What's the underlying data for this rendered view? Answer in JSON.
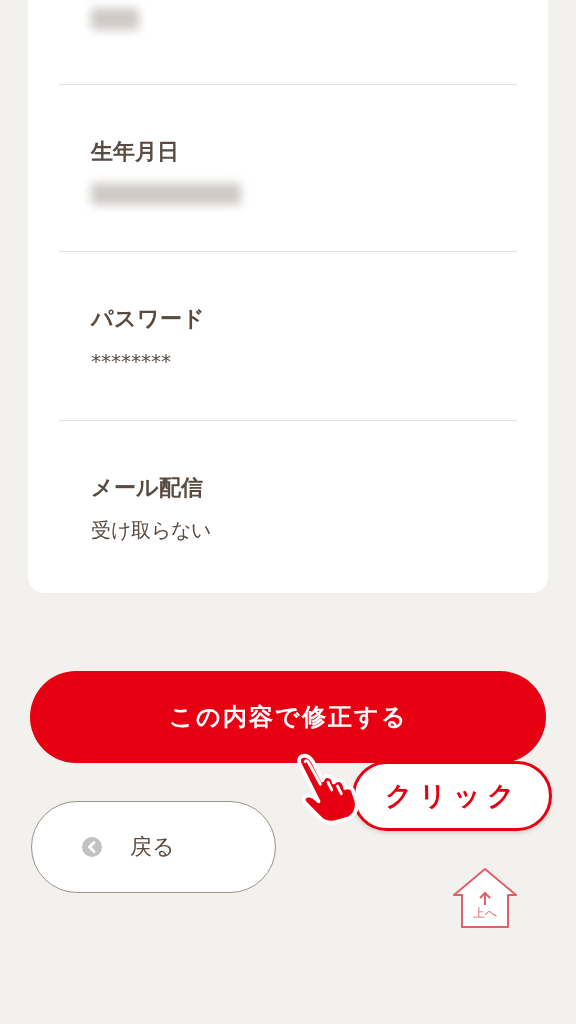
{
  "fields": [
    {
      "kind": "blurred"
    },
    {
      "label": "生年月日",
      "kind": "blurred"
    },
    {
      "label": "パスワード",
      "kind": "text",
      "value": "********"
    },
    {
      "label": "メール配信",
      "kind": "text",
      "value": "受け取らない"
    }
  ],
  "submit_button": "この内容で修正する",
  "click_hint": "クリック",
  "back_button": "戻る",
  "top_button": "上へ"
}
